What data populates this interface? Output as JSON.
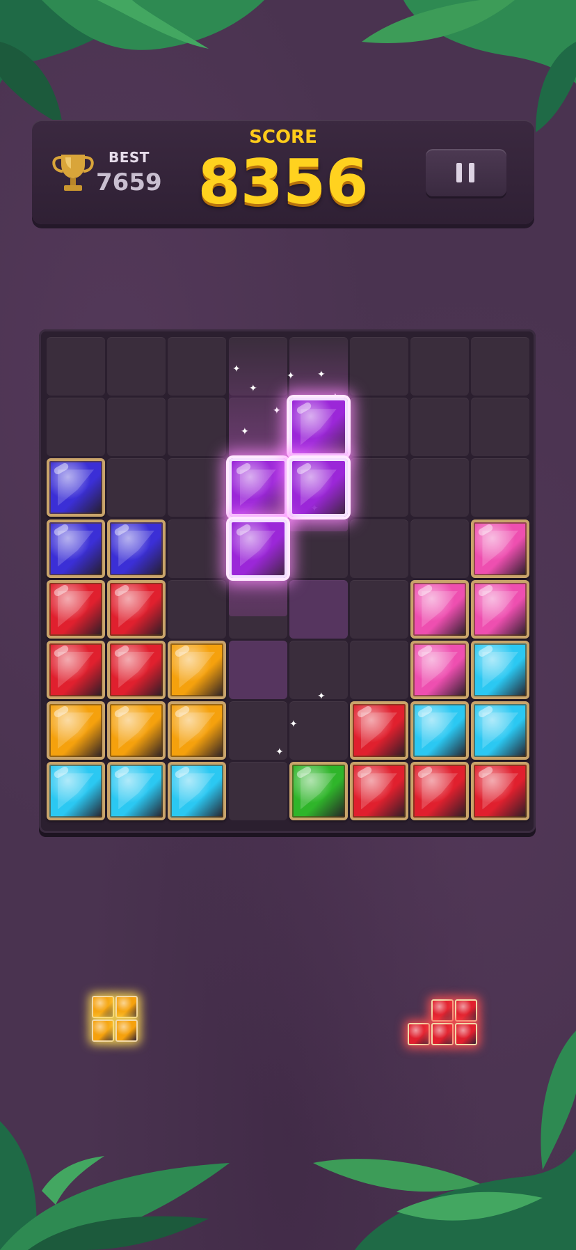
{
  "header": {
    "best_label": "BEST",
    "best_value": "7659",
    "score_label": "SCORE",
    "score_value": "8356",
    "pause_icon": "pause-icon",
    "trophy_icon": "trophy-icon"
  },
  "colors": {
    "blue": "#3b2fd6",
    "red": "#e0202e",
    "yellow": "#f5a10d",
    "cyan": "#2bc8f2",
    "pink": "#ee4fb0",
    "green": "#2fb52a",
    "purple": "#9b27d8"
  },
  "board": {
    "rows": 8,
    "cols": 8,
    "grid": [
      [
        "",
        "",
        "",
        "",
        "",
        "",
        "",
        ""
      ],
      [
        "",
        "",
        "",
        "",
        "",
        "",
        "",
        ""
      ],
      [
        "blue",
        "",
        "",
        "",
        "",
        "",
        "",
        ""
      ],
      [
        "blue",
        "blue",
        "",
        "",
        "",
        "",
        "",
        "pink"
      ],
      [
        "red",
        "red",
        "",
        "",
        "",
        "",
        "pink",
        "pink"
      ],
      [
        "red",
        "red",
        "yellow",
        "",
        "",
        "",
        "pink",
        "cyan"
      ],
      [
        "yellow",
        "yellow",
        "yellow",
        "",
        "",
        "red",
        "cyan",
        "cyan"
      ],
      [
        "cyan",
        "cyan",
        "cyan",
        "",
        "green",
        "red",
        "red",
        "red"
      ]
    ],
    "active_piece": {
      "color": "purple",
      "cells": [
        [
          1,
          4
        ],
        [
          2,
          3
        ],
        [
          2,
          4
        ],
        [
          3,
          3
        ]
      ]
    },
    "ghost_cells": [
      [
        4,
        4
      ],
      [
        5,
        3
      ]
    ]
  },
  "tray": [
    {
      "color": "yellow",
      "shape": "2x2-square"
    },
    {
      "color": "red",
      "shape": "s-block"
    }
  ]
}
